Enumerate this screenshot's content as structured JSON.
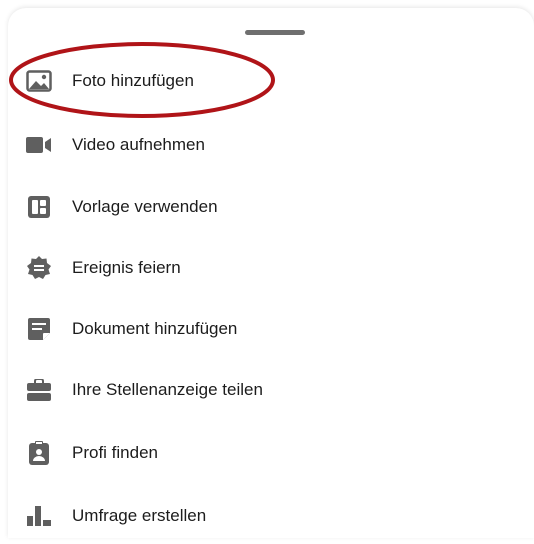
{
  "sheet": {
    "items": [
      {
        "label": "Foto hinzufügen",
        "icon": "image-icon"
      },
      {
        "label": "Video aufnehmen",
        "icon": "video-camera-icon"
      },
      {
        "label": "Vorlage verwenden",
        "icon": "template-icon"
      },
      {
        "label": "Ereignis feiern",
        "icon": "celebrate-badge-icon"
      },
      {
        "label": "Dokument hinzufügen",
        "icon": "document-icon"
      },
      {
        "label": "Ihre Stellenanzeige teilen",
        "icon": "briefcase-icon"
      },
      {
        "label": "Profi finden",
        "icon": "id-badge-icon"
      },
      {
        "label": "Umfrage erstellen",
        "icon": "poll-icon"
      }
    ]
  },
  "colors": {
    "icon": "#5f5f5f",
    "text": "#1c1c1c",
    "annotation": "#b01418"
  }
}
